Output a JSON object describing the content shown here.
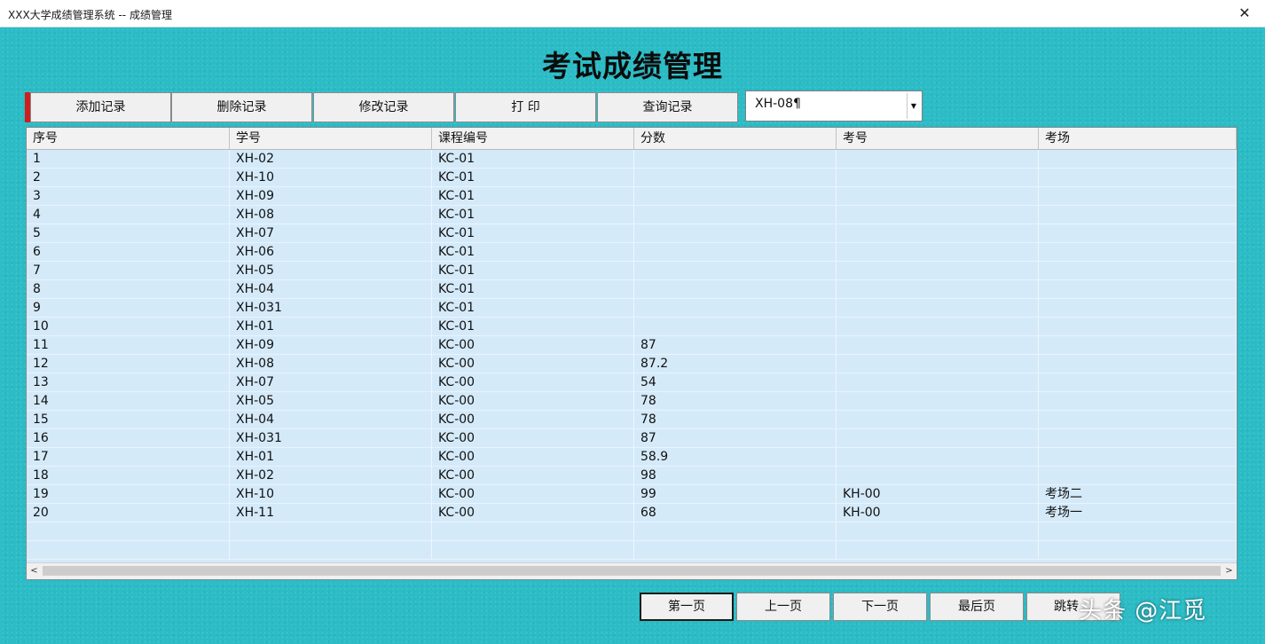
{
  "window": {
    "title": "XXX大学成绩管理系统 -- 成绩管理",
    "close_glyph": "✕"
  },
  "page_title": "考试成绩管理",
  "toolbar": {
    "add_label": "添加记录",
    "delete_label": "删除记录",
    "edit_label": "修改记录",
    "print_label": "打 印",
    "query_label": "查询记录"
  },
  "query_combo": {
    "value": "XH-08¶",
    "arrow_glyph": "▼"
  },
  "table": {
    "columns": [
      "序号",
      "学号",
      "课程编号",
      "分数",
      "考号",
      "考场"
    ],
    "rows": [
      [
        "1",
        "XH-02",
        "KC-01",
        "",
        "",
        ""
      ],
      [
        "2",
        "XH-10",
        "KC-01",
        "",
        "",
        ""
      ],
      [
        "3",
        "XH-09",
        "KC-01",
        "",
        "",
        ""
      ],
      [
        "4",
        "XH-08",
        "KC-01",
        "",
        "",
        ""
      ],
      [
        "5",
        "XH-07",
        "KC-01",
        "",
        "",
        ""
      ],
      [
        "6",
        "XH-06",
        "KC-01",
        "",
        "",
        ""
      ],
      [
        "7",
        "XH-05",
        "KC-01",
        "",
        "",
        ""
      ],
      [
        "8",
        "XH-04",
        "KC-01",
        "",
        "",
        ""
      ],
      [
        "9",
        "XH-031",
        "KC-01",
        "",
        "",
        ""
      ],
      [
        "10",
        "XH-01",
        "KC-01",
        "",
        "",
        ""
      ],
      [
        "11",
        "XH-09",
        "KC-00",
        "87",
        "",
        ""
      ],
      [
        "12",
        "XH-08",
        "KC-00",
        "87.2",
        "",
        ""
      ],
      [
        "13",
        "XH-07",
        "KC-00",
        "54",
        "",
        ""
      ],
      [
        "14",
        "XH-05",
        "KC-00",
        "78",
        "",
        ""
      ],
      [
        "15",
        "XH-04",
        "KC-00",
        "78",
        "",
        ""
      ],
      [
        "16",
        "XH-031",
        "KC-00",
        "87",
        "",
        ""
      ],
      [
        "17",
        "XH-01",
        "KC-00",
        "58.9",
        "",
        ""
      ],
      [
        "18",
        "XH-02",
        "KC-00",
        "98",
        "",
        ""
      ],
      [
        "19",
        "XH-10",
        "KC-00",
        "99",
        "KH-00",
        "考场二"
      ],
      [
        "20",
        "XH-11",
        "KC-00",
        "68",
        "KH-00",
        "考场一"
      ],
      [
        "",
        "",
        "",
        "",
        "",
        ""
      ],
      [
        "",
        "",
        "",
        "",
        "",
        ""
      ]
    ]
  },
  "scrollbar": {
    "left_glyph": "<",
    "right_glyph": ">"
  },
  "pager": {
    "first_label": "第一页",
    "prev_label": "上一页",
    "next_label": "下一页",
    "last_label": "最后页",
    "jump_label": "跳转"
  },
  "watermark": "头条 @江觅"
}
